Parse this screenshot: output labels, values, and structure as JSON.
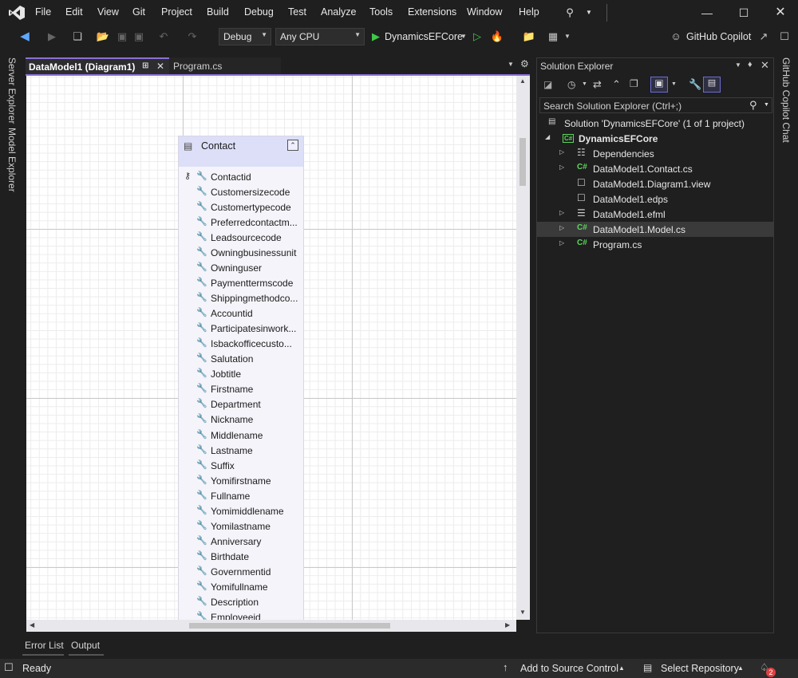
{
  "menu": {
    "items": [
      "File",
      "Edit",
      "View",
      "Git",
      "Project",
      "Build",
      "Debug",
      "Test",
      "Analyze",
      "Tools",
      "Extensions",
      "Window",
      "Help"
    ]
  },
  "toolbar": {
    "config": "Debug",
    "platform": "Any CPU",
    "startup": "DynamicsEFCore",
    "copilot": "GitHub Copilot"
  },
  "left_tabs": [
    "Server Explorer",
    "Model Explorer"
  ],
  "editor": {
    "active_tab": "DataModel1 (Diagram1)",
    "inactive_tab": "Program.cs"
  },
  "entity": {
    "title": "Contact",
    "properties": [
      "Contactid",
      "Customersizecode",
      "Customertypecode",
      "Preferredcontactm...",
      "Leadsourcecode",
      "Owningbusinessunit",
      "Owninguser",
      "Paymenttermscode",
      "Shippingmethodco...",
      "Accountid",
      "Participatesinwork...",
      "Isbackofficecusto...",
      "Salutation",
      "Jobtitle",
      "Firstname",
      "Department",
      "Nickname",
      "Middlename",
      "Lastname",
      "Suffix",
      "Yomifirstname",
      "Fullname",
      "Yomimiddlename",
      "Yomilastname",
      "Anniversary",
      "Birthdate",
      "Governmentid",
      "Yomifullname",
      "Description",
      "Employeeid"
    ]
  },
  "solution_explorer": {
    "title": "Solution Explorer",
    "search_placeholder": "Search Solution Explorer (Ctrl+;)",
    "solution": "Solution 'DynamicsEFCore' (1 of 1 project)",
    "project": "DynamicsEFCore",
    "items": [
      {
        "label": "Dependencies",
        "icon": "dependencies-icon",
        "expandable": true
      },
      {
        "label": "DataModel1.Contact.cs",
        "icon": "csharp-file-icon",
        "expandable": true
      },
      {
        "label": "DataModel1.Diagram1.view",
        "icon": "file-icon",
        "expandable": false
      },
      {
        "label": "DataModel1.edps",
        "icon": "file-icon",
        "expandable": false
      },
      {
        "label": "DataModel1.efml",
        "icon": "efml-file-icon",
        "expandable": true
      },
      {
        "label": "DataModel1.Model.cs",
        "icon": "csharp-file-icon",
        "expandable": true,
        "selected": true
      },
      {
        "label": "Program.cs",
        "icon": "csharp-file-icon",
        "expandable": true
      }
    ]
  },
  "right_tab": "GitHub Copilot Chat",
  "bottom_tabs": [
    "Error List",
    "Output"
  ],
  "status": {
    "ready": "Ready",
    "source_control": "Add to Source Control",
    "repository": "Select Repository",
    "notifications": "2"
  },
  "colors": {
    "accent": "#8a6fd6",
    "entity_header": "#dcdff7",
    "csharp_icon": "#5cd65c"
  }
}
